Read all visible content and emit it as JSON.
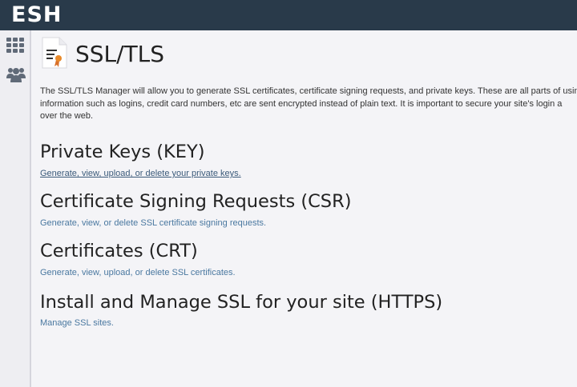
{
  "header": {
    "logo": "ESH"
  },
  "page": {
    "title": "SSL/TLS"
  },
  "intro": {
    "text": "The SSL/TLS Manager will allow you to generate SSL certificates, certificate signing requests, and private keys. These are all parts of usin\ninformation such as logins, credit card numbers, etc are sent encrypted instead of plain text. It is important to secure your site's login a\nover the web."
  },
  "sections": [
    {
      "title": "Private Keys (KEY)",
      "link": "Generate, view, upload, or delete your private keys."
    },
    {
      "title": "Certificate Signing Requests (CSR)",
      "link": "Generate, view, or delete SSL certificate signing requests."
    },
    {
      "title": "Certificates (CRT)",
      "link": "Generate, view, upload, or delete SSL certificates."
    },
    {
      "title": "Install and Manage SSL for your site (HTTPS)",
      "link": "Manage SSL sites."
    }
  ],
  "icons": {
    "sidebar": [
      "grid-icon",
      "users-icon"
    ],
    "page": "ssl-certificate-icon"
  },
  "colors": {
    "topbar": "#293a4a",
    "link": "#4a78a0",
    "sidebar_icon": "#606a78",
    "ribbon": "#e8892a"
  }
}
